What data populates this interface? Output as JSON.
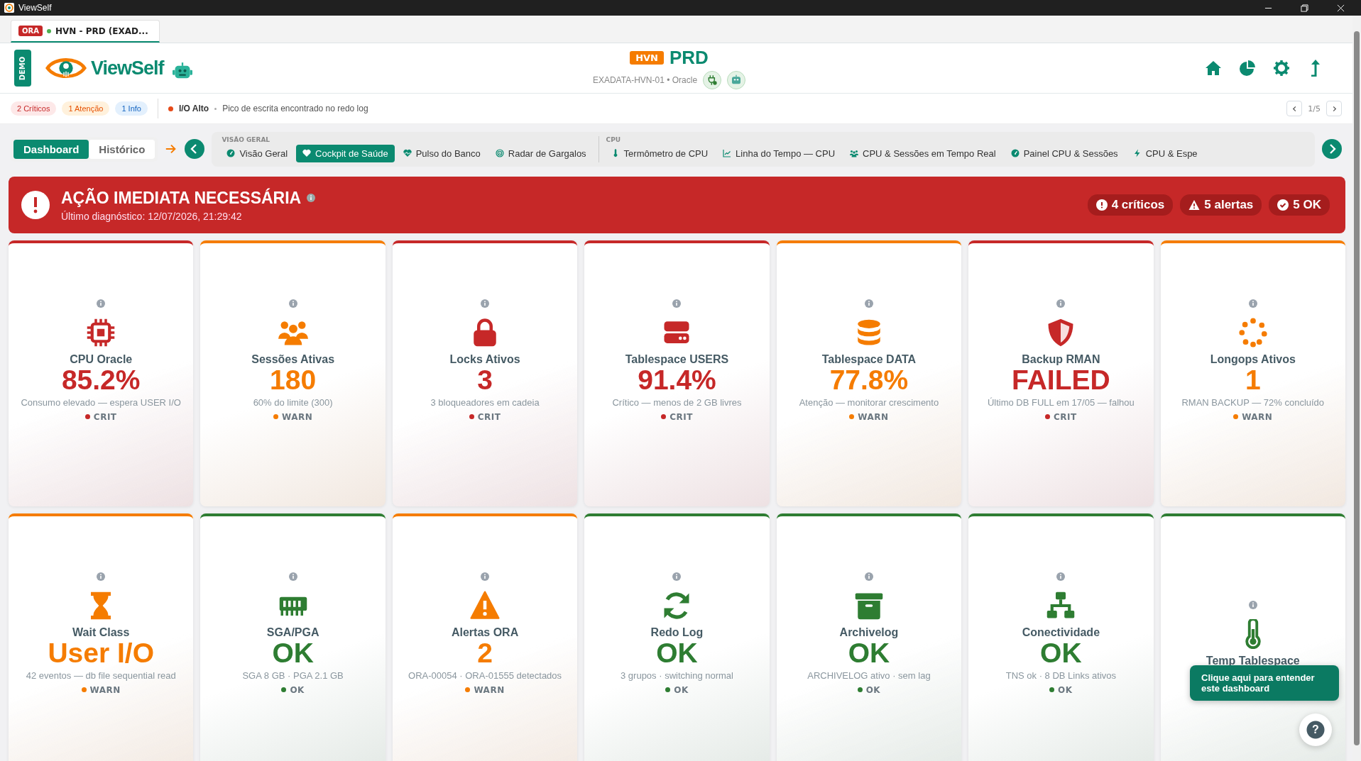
{
  "window": {
    "title": "ViewSelf"
  },
  "tab": {
    "badge": "ORA",
    "label": "HVN - PRD (EXAD..."
  },
  "header": {
    "demo": "DEMO",
    "logo": "ViewSelf",
    "env_badge": "HVN",
    "env": "PRD",
    "subtitle": "EXADATA-HVN-01 • Oracle"
  },
  "alerts": {
    "pills": [
      {
        "kind": "crit",
        "label": "2 Críticos"
      },
      {
        "kind": "warn",
        "label": "1 Atenção"
      },
      {
        "kind": "info",
        "label": "1 Info"
      }
    ],
    "event": {
      "title": "I/O Alto",
      "message": "Pico de escrita encontrado no redo log"
    },
    "pager": "1/5"
  },
  "nav": {
    "modes": [
      {
        "label": "Dashboard",
        "selected": true
      },
      {
        "label": "Histórico",
        "selected": false
      }
    ],
    "groups": [
      {
        "title": "VISÃO GERAL",
        "items": [
          {
            "label": "Visão Geral",
            "selected": false
          },
          {
            "label": "Cockpit de Saúde",
            "selected": true
          },
          {
            "label": "Pulso do Banco",
            "selected": false
          },
          {
            "label": "Radar de Gargalos",
            "selected": false
          }
        ]
      },
      {
        "title": "CPU",
        "items": [
          {
            "label": "Termômetro de CPU",
            "selected": false
          },
          {
            "label": "Linha do Tempo — CPU",
            "selected": false
          },
          {
            "label": "CPU & Sessões em Tempo Real",
            "selected": false
          },
          {
            "label": "Painel CPU & Sessões",
            "selected": false
          },
          {
            "label": "CPU & Espe",
            "selected": false
          }
        ]
      }
    ]
  },
  "banner": {
    "title": "AÇÃO IMEDIATA NECESSÁRIA",
    "subtitle": "Último diagnóstico: 12/07/2026, 21:29:42",
    "counts": [
      {
        "kind": "crit",
        "label": "4 críticos"
      },
      {
        "kind": "warn",
        "label": "5 alertas"
      },
      {
        "kind": "ok",
        "label": "5 OK"
      }
    ]
  },
  "cards": [
    {
      "title": "CPU Oracle",
      "value": "85.2%",
      "detail": "Consumo elevado — espera USER I/O",
      "color": "#c62828",
      "status": "CRIT"
    },
    {
      "title": "Sessões Ativas",
      "value": "180",
      "detail": "60% do limite (300)",
      "color": "#f57c00",
      "status": "WARN"
    },
    {
      "title": "Locks Ativos",
      "value": "3",
      "detail": "3 bloqueadores em cadeia",
      "color": "#c62828",
      "status": "CRIT"
    },
    {
      "title": "Tablespace USERS",
      "value": "91.4%",
      "detail": "Crítico — menos de 2 GB livres",
      "color": "#c62828",
      "status": "CRIT"
    },
    {
      "title": "Tablespace DATA",
      "value": "77.8%",
      "detail": "Atenção — monitorar crescimento",
      "color": "#f57c00",
      "status": "WARN"
    },
    {
      "title": "Backup RMAN",
      "value": "FAILED",
      "detail": "Último DB FULL em 17/05 — falhou",
      "color": "#c62828",
      "status": "CRIT"
    },
    {
      "title": "Longops Ativos",
      "value": "1",
      "detail": "RMAN BACKUP — 72% concluído",
      "color": "#f57c00",
      "status": "WARN"
    },
    {
      "title": "Wait Class",
      "value": "User I/O",
      "detail": "42 eventos — db file sequential read",
      "color": "#f57c00",
      "status": "WARN"
    },
    {
      "title": "SGA/PGA",
      "value": "OK",
      "detail": "SGA 8 GB · PGA 2.1 GB",
      "color": "#2e7d32",
      "status": "OK"
    },
    {
      "title": "Alertas ORA",
      "value": "2",
      "detail": "ORA-00054 · ORA-01555 detectados",
      "color": "#f57c00",
      "status": "WARN"
    },
    {
      "title": "Redo Log",
      "value": "OK",
      "detail": "3 grupos · switching normal",
      "color": "#2e7d32",
      "status": "OK"
    },
    {
      "title": "Archivelog",
      "value": "OK",
      "detail": "ARCHIVELOG ativo · sem lag",
      "color": "#2e7d32",
      "status": "OK"
    },
    {
      "title": "Conectividade",
      "value": "OK",
      "detail": "TNS ok · 8 DB Links ativos",
      "color": "#2e7d32",
      "status": "OK"
    },
    {
      "title": "Temp Tablespace",
      "color": "#2e7d32"
    }
  ],
  "tooltip": "Clique aqui para entender este dashboard",
  "help": "?"
}
